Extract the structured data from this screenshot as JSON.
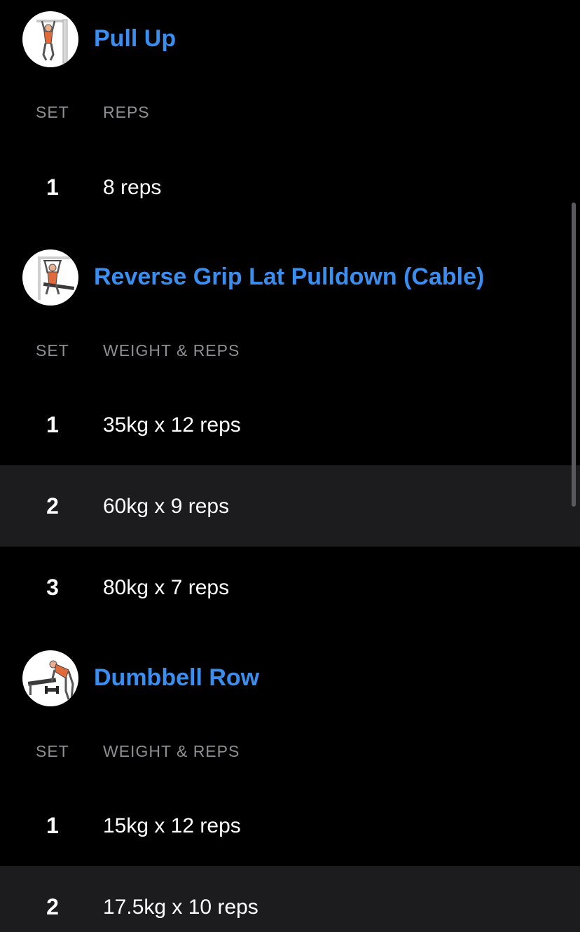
{
  "accent_color": "#3a8ef0",
  "exercises": [
    {
      "name": "Pull Up",
      "icon": "pull-up-thumbnail",
      "col_set": "SET",
      "col_value": "REPS",
      "sets": [
        {
          "num": "1",
          "value": "8 reps",
          "highlighted": false
        }
      ]
    },
    {
      "name": "Reverse Grip Lat Pulldown (Cable)",
      "icon": "lat-pulldown-thumbnail",
      "col_set": "SET",
      "col_value": "WEIGHT & REPS",
      "sets": [
        {
          "num": "1",
          "value": "35kg x 12 reps",
          "highlighted": false
        },
        {
          "num": "2",
          "value": "60kg x 9 reps",
          "highlighted": true
        },
        {
          "num": "3",
          "value": "80kg x 7 reps",
          "highlighted": false
        }
      ]
    },
    {
      "name": "Dumbbell Row",
      "icon": "dumbbell-row-thumbnail",
      "col_set": "SET",
      "col_value": "WEIGHT & REPS",
      "sets": [
        {
          "num": "1",
          "value": "15kg x 12 reps",
          "highlighted": false
        },
        {
          "num": "2",
          "value": "17.5kg x 10 reps",
          "highlighted": true
        }
      ]
    }
  ]
}
